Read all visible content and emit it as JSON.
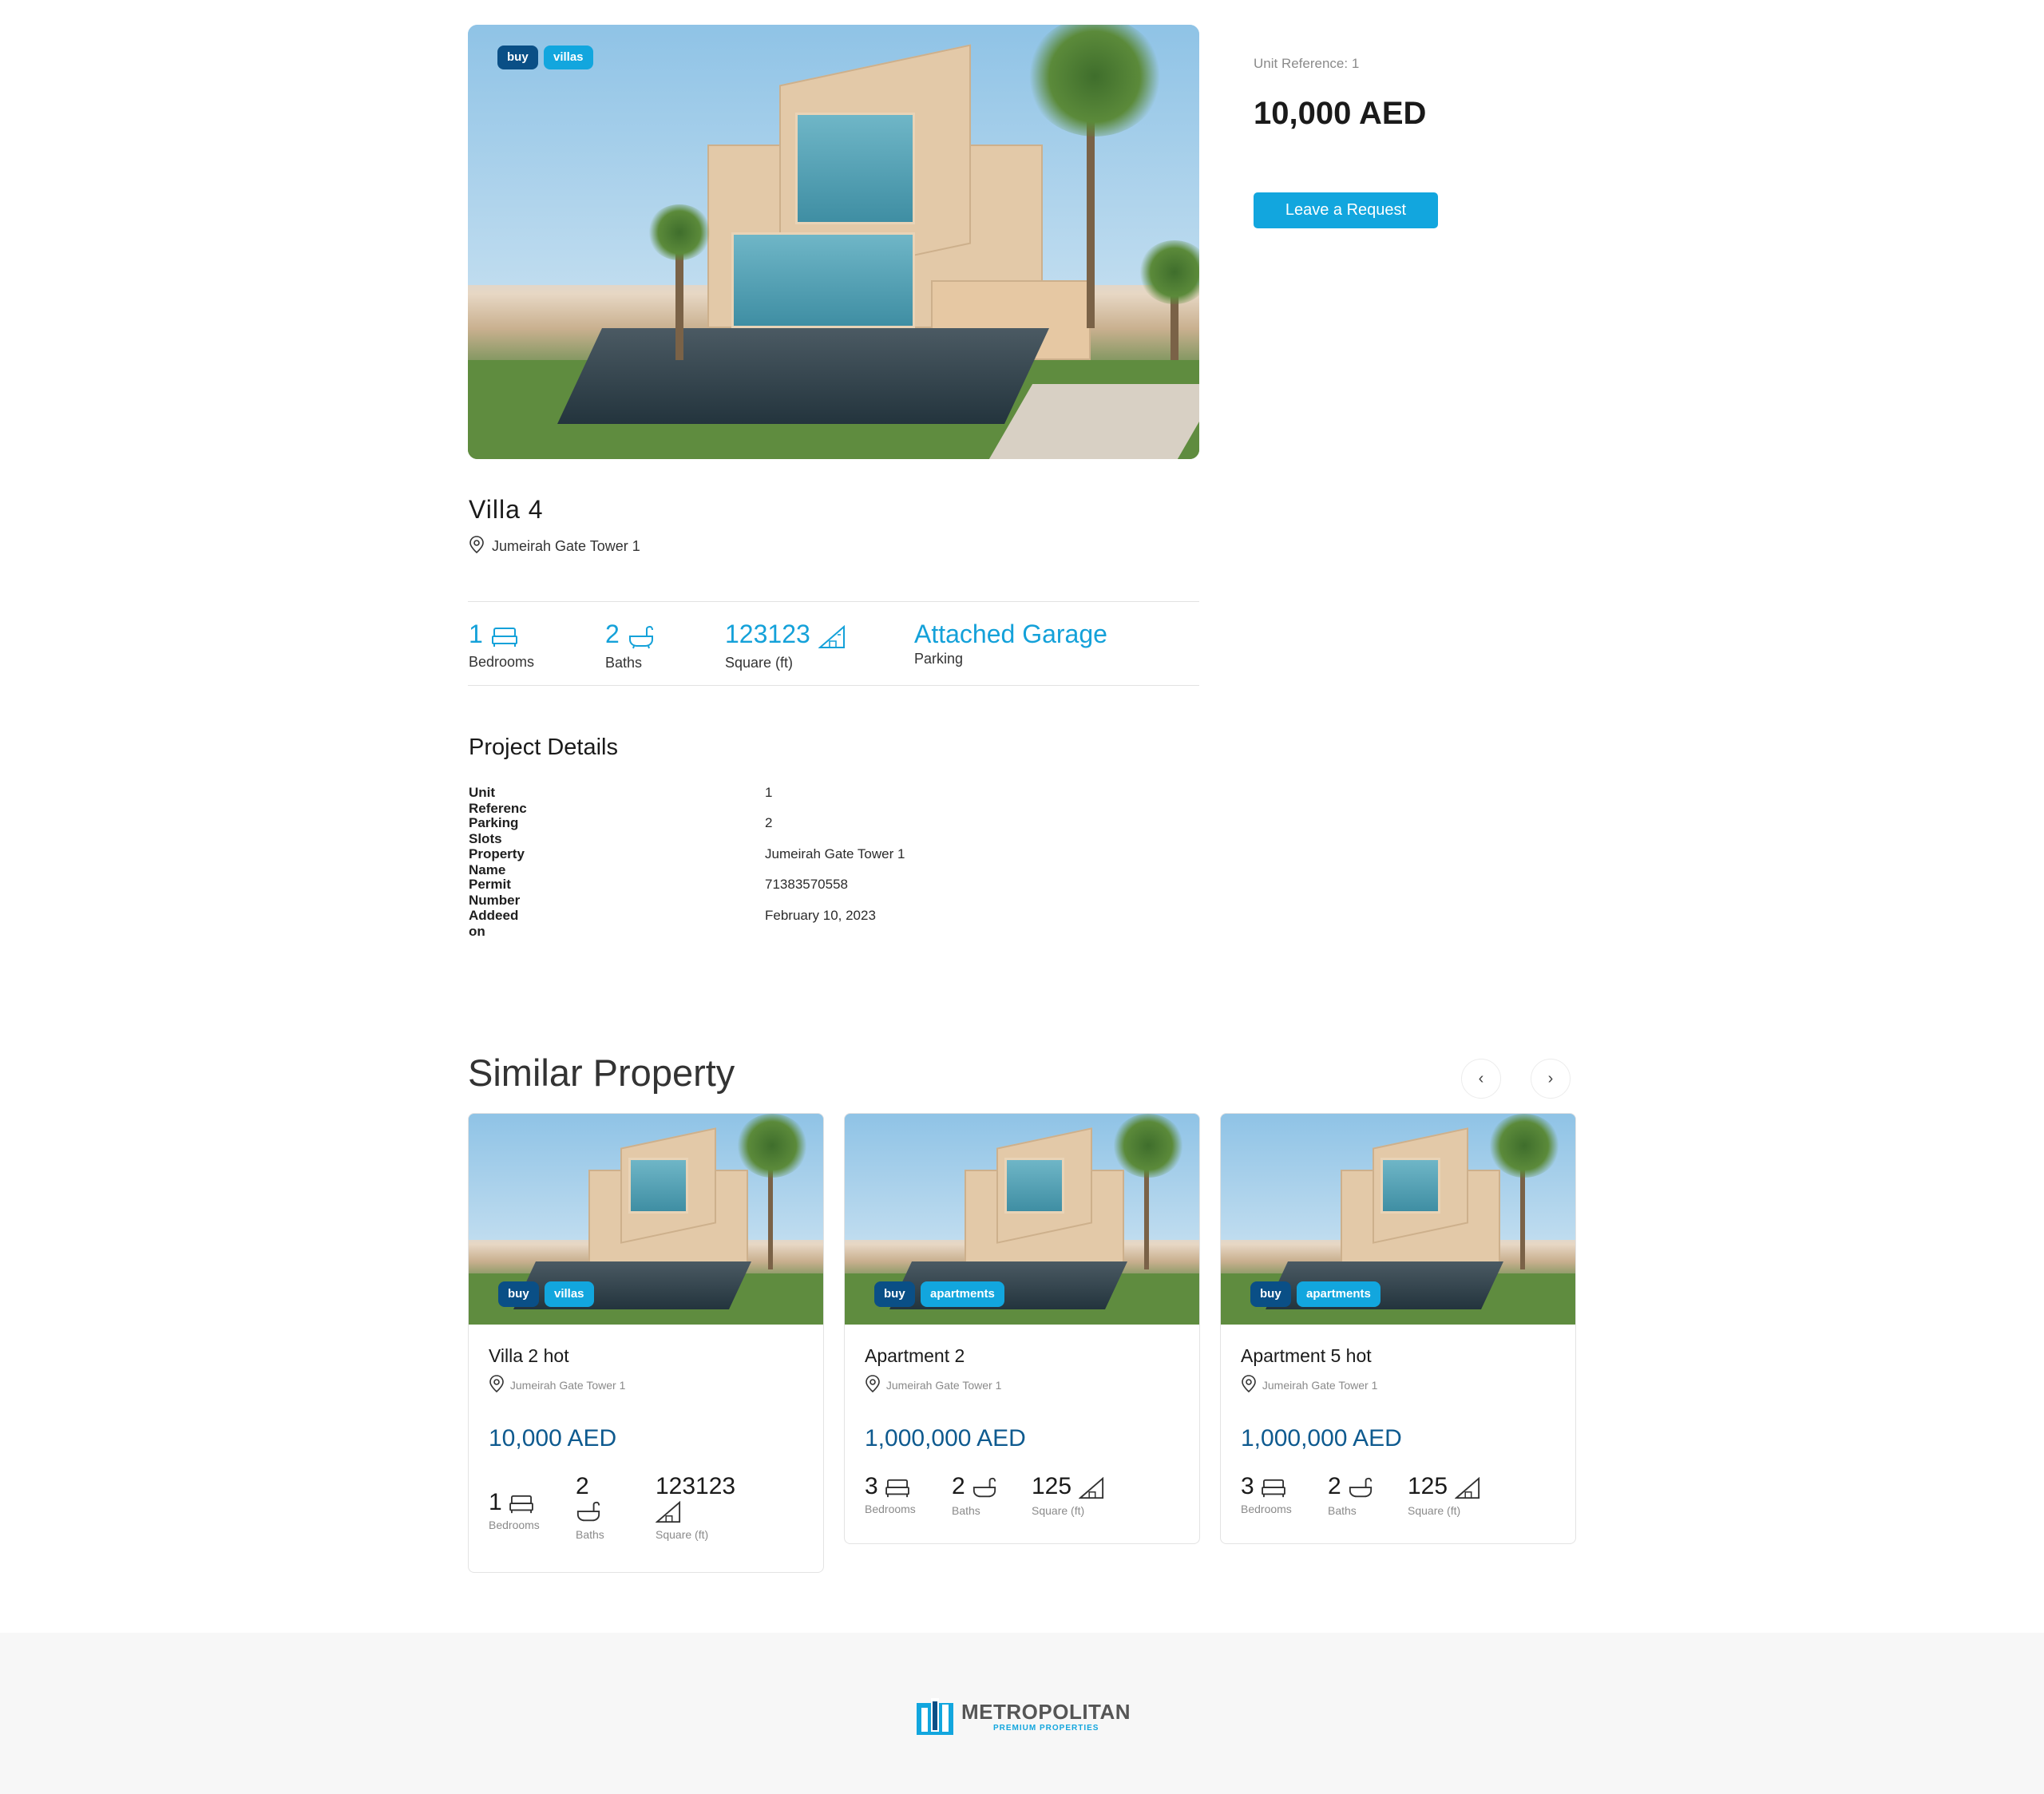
{
  "hero": {
    "tags": [
      "buy",
      "villas"
    ],
    "title": "Villa 4",
    "location": "Jumeirah Gate Tower 1"
  },
  "sidebar": {
    "unit_reference": "Unit Reference: 1",
    "price": "10,000 AED",
    "request_button": "Leave a Request"
  },
  "stats": [
    {
      "value": "1",
      "label": "Bedrooms",
      "icon": "bed-icon"
    },
    {
      "value": "2",
      "label": "Baths",
      "icon": "bathtub-icon"
    },
    {
      "value": "123123",
      "label": "Square (ft)",
      "icon": "area-icon"
    },
    {
      "value": "Attached Garage",
      "label": "Parking"
    }
  ],
  "project_details": {
    "heading": "Project Details",
    "rows": [
      {
        "key": "Unit Referenc",
        "value": "1"
      },
      {
        "key": "Parking Slots",
        "value": "2"
      },
      {
        "key": "Property Name",
        "value": "Jumeirah Gate Tower 1"
      },
      {
        "key": "Permit Number",
        "value": "71383570558"
      },
      {
        "key": "Addeed on",
        "value": "February 10, 2023"
      }
    ]
  },
  "similar": {
    "heading": "Similar Property",
    "prev_icon": "chevron-left-icon",
    "next_icon": "chevron-right-icon",
    "cards": [
      {
        "tags": [
          "buy",
          "villas"
        ],
        "title": "Villa 2 hot",
        "location": "Jumeirah Gate Tower 1",
        "price": "10,000 AED",
        "bedrooms": "1",
        "baths": "2",
        "area": "123123",
        "bedrooms_label": "Bedrooms",
        "baths_label": "Baths",
        "area_label": "Square (ft)"
      },
      {
        "tags": [
          "buy",
          "apartments"
        ],
        "title": "Apartment 2",
        "location": "Jumeirah Gate Tower 1",
        "price": "1,000,000 AED",
        "bedrooms": "3",
        "baths": "2",
        "area": "125",
        "bedrooms_label": "Bedrooms",
        "baths_label": "Baths",
        "area_label": "Square (ft)"
      },
      {
        "tags": [
          "buy",
          "apartments"
        ],
        "title": "Apartment 5 hot",
        "location": "Jumeirah Gate Tower 1",
        "price": "1,000,000 AED",
        "bedrooms": "3",
        "baths": "2",
        "area": "125",
        "bedrooms_label": "Bedrooms",
        "baths_label": "Baths",
        "area_label": "Square (ft)"
      }
    ]
  },
  "footer": {
    "logo_name": "METROPOLITAN",
    "logo_tagline": "PREMIUM PROPERTIES"
  },
  "colors": {
    "accent": "#14a1d9",
    "brand_dark": "#0a4f86",
    "price_blue": "#0e5a8f"
  }
}
